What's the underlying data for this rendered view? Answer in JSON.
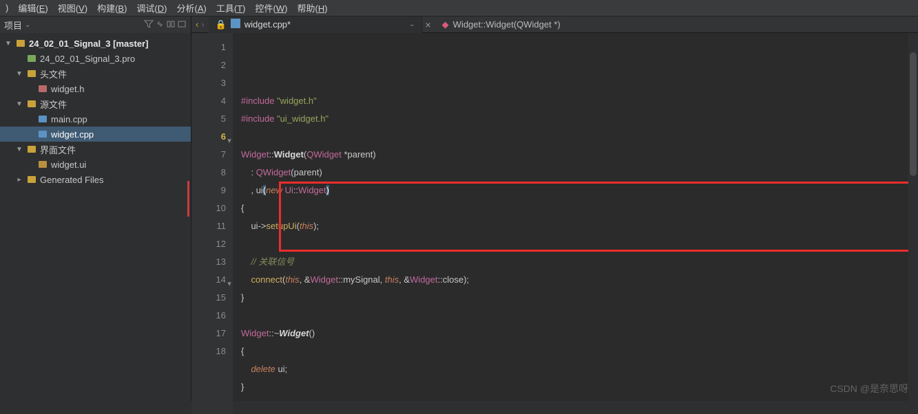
{
  "menu": {
    "items": [
      ")",
      "编辑(E)",
      "视图(V)",
      "构建(B)",
      "调试(D)",
      "分析(A)",
      "工具(T)",
      "控件(W)",
      "帮助(H)"
    ]
  },
  "sidebar": {
    "title": "项目",
    "tree": [
      {
        "label": "24_02_01_Signal_3 [master]",
        "indent": 0,
        "tw": "▼",
        "icon": "project",
        "bold": true
      },
      {
        "label": "24_02_01_Signal_3.pro",
        "indent": 1,
        "tw": "",
        "icon": "pro"
      },
      {
        "label": "头文件",
        "indent": 1,
        "tw": "▼",
        "icon": "folder"
      },
      {
        "label": "widget.h",
        "indent": 2,
        "tw": "",
        "icon": "h"
      },
      {
        "label": "源文件",
        "indent": 1,
        "tw": "▼",
        "icon": "folder"
      },
      {
        "label": "main.cpp",
        "indent": 2,
        "tw": "",
        "icon": "cpp"
      },
      {
        "label": "widget.cpp",
        "indent": 2,
        "tw": "",
        "icon": "cpp",
        "sel": true
      },
      {
        "label": "界面文件",
        "indent": 1,
        "tw": "▼",
        "icon": "folder"
      },
      {
        "label": "widget.ui",
        "indent": 2,
        "tw": "",
        "icon": "ui"
      },
      {
        "label": "Generated Files",
        "indent": 1,
        "tw": "▸",
        "icon": "folder"
      }
    ]
  },
  "tabs": {
    "file": "widget.cpp*",
    "crumb": "Widget::Widget(QWidget *)"
  },
  "code": {
    "lines": [
      {
        "n": "1",
        "t": [
          [
            "kw",
            "#include "
          ],
          [
            "str",
            "\"widget.h\""
          ]
        ]
      },
      {
        "n": "2",
        "t": [
          [
            "kw",
            "#include "
          ],
          [
            "str",
            "\"ui_widget.h\""
          ]
        ]
      },
      {
        "n": "3",
        "t": [
          [
            "",
            ""
          ]
        ]
      },
      {
        "n": "4",
        "t": [
          [
            "type",
            "Widget"
          ],
          [
            "op",
            "::"
          ],
          [
            "boldfn",
            "Widget"
          ],
          [
            "op",
            "("
          ],
          [
            "type",
            "QWidget"
          ],
          [
            "op",
            " *"
          ],
          [
            "ident",
            "parent"
          ],
          [
            "op",
            ")"
          ]
        ]
      },
      {
        "n": "5",
        "t": [
          [
            "",
            "    "
          ],
          [
            "op",
            ": "
          ],
          [
            "type",
            "QWidget"
          ],
          [
            "op",
            "("
          ],
          [
            "ident",
            "parent"
          ],
          [
            "op",
            ")"
          ]
        ]
      },
      {
        "n": "6",
        "cur": true,
        "fold": "▾",
        "t": [
          [
            "",
            "    "
          ],
          [
            "op",
            ", "
          ],
          [
            "ident",
            "ui"
          ],
          [
            "paren-hl",
            "("
          ],
          [
            "kw2",
            "new"
          ],
          [
            "op",
            " "
          ],
          [
            "type",
            "Ui"
          ],
          [
            "op",
            "::"
          ],
          [
            "type",
            "Widget"
          ],
          [
            "paren-hl",
            ")"
          ]
        ]
      },
      {
        "n": "7",
        "t": [
          [
            "op",
            "{"
          ]
        ]
      },
      {
        "n": "8",
        "t": [
          [
            "",
            "    "
          ],
          [
            "ident",
            "ui"
          ],
          [
            "op",
            "->"
          ],
          [
            "fn",
            "setupUi"
          ],
          [
            "op",
            "("
          ],
          [
            "this",
            "this"
          ],
          [
            "op",
            ");"
          ]
        ]
      },
      {
        "n": "9",
        "t": [
          [
            "",
            ""
          ]
        ]
      },
      {
        "n": "10",
        "t": [
          [
            "",
            "    "
          ],
          [
            "comment",
            "// 关联信号"
          ]
        ]
      },
      {
        "n": "11",
        "t": [
          [
            "",
            "    "
          ],
          [
            "fn",
            "connect"
          ],
          [
            "op",
            "("
          ],
          [
            "this",
            "this"
          ],
          [
            "op",
            ", &"
          ],
          [
            "type",
            "Widget"
          ],
          [
            "op",
            "::"
          ],
          [
            "ident",
            "mySignal"
          ],
          [
            "op",
            ", "
          ],
          [
            "this",
            "this"
          ],
          [
            "op",
            ", &"
          ],
          [
            "type",
            "Widget"
          ],
          [
            "op",
            "::"
          ],
          [
            "ident",
            "close"
          ],
          [
            "op",
            ");"
          ]
        ]
      },
      {
        "n": "12",
        "t": [
          [
            "op",
            "}"
          ]
        ]
      },
      {
        "n": "13",
        "t": [
          [
            "",
            ""
          ]
        ]
      },
      {
        "n": "14",
        "fold": "▾",
        "t": [
          [
            "type",
            "Widget"
          ],
          [
            "op",
            "::~"
          ],
          [
            "boldfn italic",
            "Widget"
          ],
          [
            "op",
            "()"
          ]
        ]
      },
      {
        "n": "15",
        "t": [
          [
            "op",
            "{"
          ]
        ]
      },
      {
        "n": "16",
        "t": [
          [
            "",
            "    "
          ],
          [
            "kw2",
            "delete"
          ],
          [
            "op",
            " "
          ],
          [
            "ident",
            "ui"
          ],
          [
            "op",
            ";"
          ]
        ]
      },
      {
        "n": "17",
        "t": [
          [
            "op",
            "}"
          ]
        ]
      },
      {
        "n": "18",
        "t": [
          [
            "",
            ""
          ]
        ]
      }
    ]
  },
  "watermark": "CSDN @是奈思呀"
}
